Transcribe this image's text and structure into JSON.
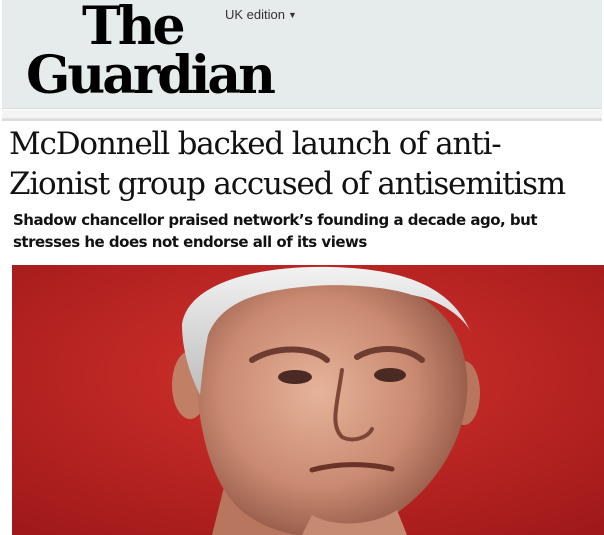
{
  "masthead": {
    "logo_line1": "The",
    "logo_line2": "Guardian",
    "edition": "UK edition",
    "edition_chevron": "⌄"
  },
  "article": {
    "headline": "McDonnell backed launch of anti-Zionist group accused of antisemitism",
    "standfirst": "Shadow chancellor praised network’s founding a decade ago, but stresses he does not endorse all of its views"
  },
  "colors": {
    "masthead_bg": "#e6eceb",
    "photo_bg": "#c0221f",
    "text": "#121212"
  },
  "icons": {
    "edition_chevron": "chevron-down-icon"
  }
}
